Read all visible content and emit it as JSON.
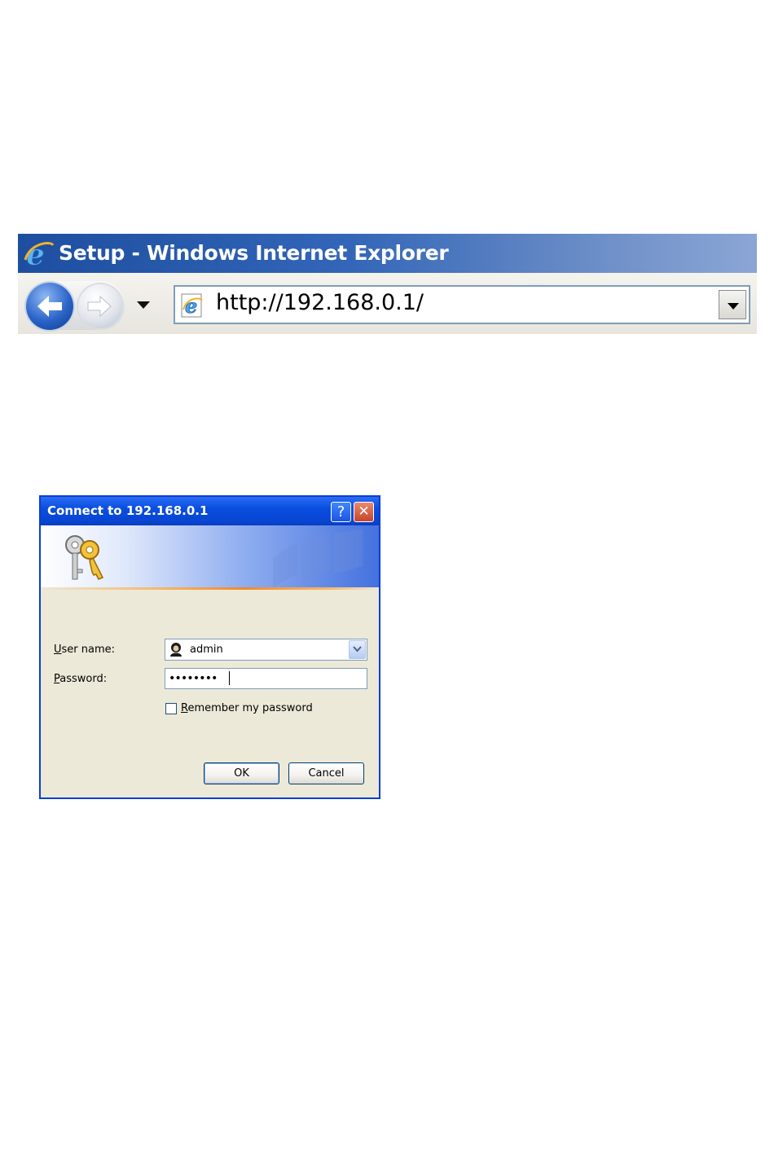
{
  "browser": {
    "title": "Setup - Windows Internet Explorer",
    "address": "http://192.168.0.1/",
    "icons": [
      "ie-logo-icon",
      "back-arrow-icon",
      "forward-arrow-icon",
      "dropdown-arrow-icon"
    ]
  },
  "dialog": {
    "title": "Connect to 192.168.0.1",
    "help_label": "?",
    "close_label": "✕",
    "username_label_accel": "U",
    "username_label_rest": "ser name:",
    "username_value": "admin",
    "password_label_accel": "P",
    "password_label_rest": "assword:",
    "password_value": "••••••••",
    "remember_accel": "R",
    "remember_rest": "emember my password",
    "remember_checked": false,
    "ok_label": "OK",
    "cancel_label": "Cancel"
  },
  "colors": {
    "ie_titlebar": "#1d4ea0",
    "dialog_titlebar": "#0a4ee0",
    "dialog_body": "#ece9d8",
    "banner_accent": "#f08a2a"
  }
}
